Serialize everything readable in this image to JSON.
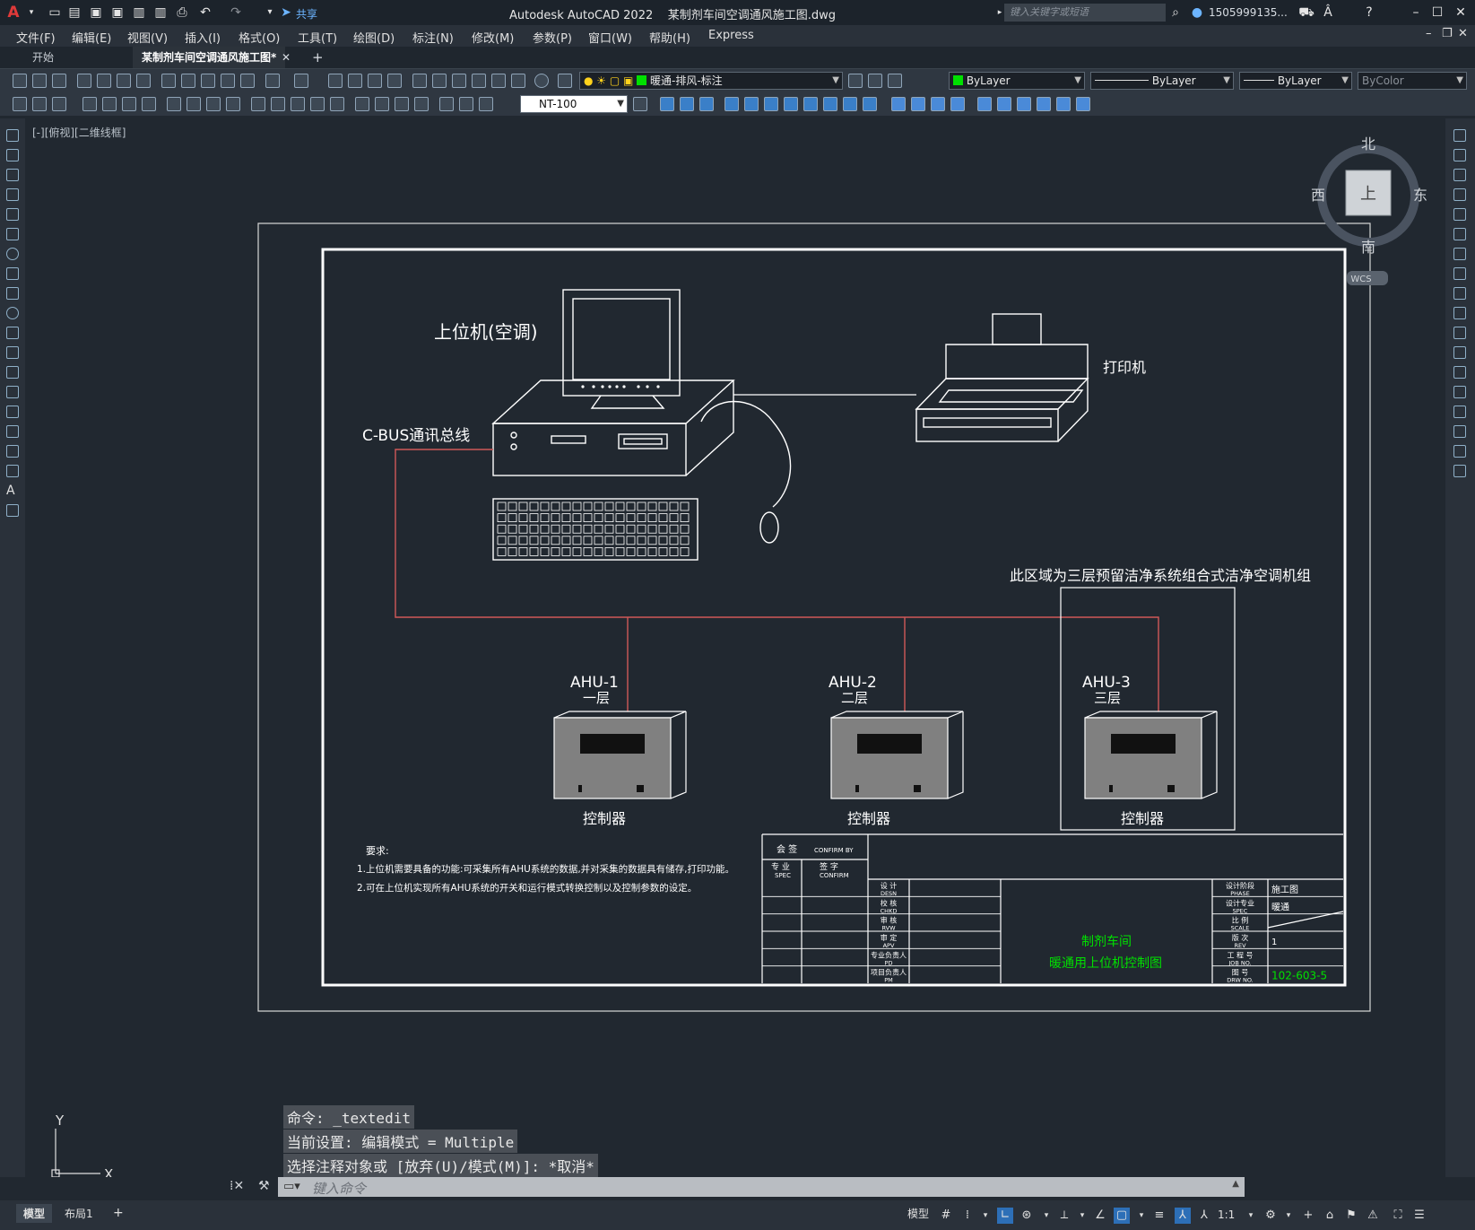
{
  "app": {
    "title": "Autodesk AutoCAD 2022",
    "document": "某制剂车间空调通风施工图.dwg",
    "search_placeholder": "键入关键字或短语",
    "user": "1505999135...",
    "share": "共享"
  },
  "menu": [
    "文件(F)",
    "编辑(E)",
    "视图(V)",
    "插入(I)",
    "格式(O)",
    "工具(T)",
    "绘图(D)",
    "标注(N)",
    "修改(M)",
    "参数(P)",
    "窗口(W)",
    "帮助(H)",
    "Express"
  ],
  "tabs": {
    "start": "开始",
    "active": "某制剂车间空调通风施工图*",
    "add": "+"
  },
  "toolbar": {
    "layer": "暖通-排风-标注",
    "color": "ByLayer",
    "linetype": "ByLayer",
    "lineweight": "ByLayer",
    "plotstyle": "ByColor",
    "textstyle": "NT-100"
  },
  "viewport_label": "[-][俯视][二维线框]",
  "viewcube": {
    "north": "北",
    "south": "南",
    "east": "东",
    "west": "西",
    "top": "上",
    "wcs": "WCS"
  },
  "drawing": {
    "host_label": "上位机(空调)",
    "bus_label": "C-BUS通讯总线",
    "printer_label": "打印机",
    "region_note": "此区域为三层预留洁净系统组合式洁净空调机组",
    "units": [
      {
        "name": "AHU-1",
        "floor": "一层",
        "label": "控制器"
      },
      {
        "name": "AHU-2",
        "floor": "二层",
        "label": "控制器"
      },
      {
        "name": "AHU-3",
        "floor": "三层",
        "label": "控制器"
      }
    ],
    "req_title": "要求:",
    "req_1": "1.上位机需要具备的功能:可采集所有AHU系统的数据,并对采集的数据具有储存,打印功能。",
    "req_2": "2.可在上位机实现所有AHU系统的开关和运行模式转换控制以及控制参数的设定。"
  },
  "titleblock": {
    "confirm_cn": "会 签",
    "confirm_en": "CONFIRM BY",
    "spec_cn": "专 业",
    "spec_en": "SPEC",
    "sign_cn": "签 字",
    "sign_en": "CONFIRM",
    "roles": [
      {
        "cn": "设 计",
        "en": "DESN"
      },
      {
        "cn": "校 核",
        "en": "CHKD"
      },
      {
        "cn": "审 核",
        "en": "RVW"
      },
      {
        "cn": "审 定",
        "en": "APV"
      },
      {
        "cn": "专业负责人",
        "en": "PD"
      },
      {
        "cn": "项目负责人",
        "en": "PM"
      }
    ],
    "project": "制剂车间",
    "drawing_name": "暖通用上位机控制图",
    "fields": [
      {
        "cn": "设计阶段",
        "en": "PHASE",
        "value": "施工图"
      },
      {
        "cn": "设计专业",
        "en": "SPEC",
        "value": "暖通"
      },
      {
        "cn": "比 例",
        "en": "SCALE",
        "value": ""
      },
      {
        "cn": "版 次",
        "en": "REV",
        "value": "1"
      },
      {
        "cn": "工 程 号",
        "en": "JOB NO.",
        "value": ""
      },
      {
        "cn": "图 号",
        "en": "DRW NO.",
        "value": "102-603-5"
      }
    ]
  },
  "ucs": {
    "x": "X",
    "y": "Y"
  },
  "command": {
    "history": [
      "命令: _textedit",
      "当前设置: 编辑模式 = Multiple",
      "选择注释对象或 [放弃(U)/模式(M)]: *取消*"
    ],
    "placeholder": "键入命令"
  },
  "status": {
    "model_tab": "模型",
    "layout_tab": "布局1",
    "model_btn": "模型",
    "scale": "1:1"
  },
  "colors": {
    "accent_green": "#00e000",
    "bus_red": "#d05858",
    "drawing_bg": "#212830"
  }
}
